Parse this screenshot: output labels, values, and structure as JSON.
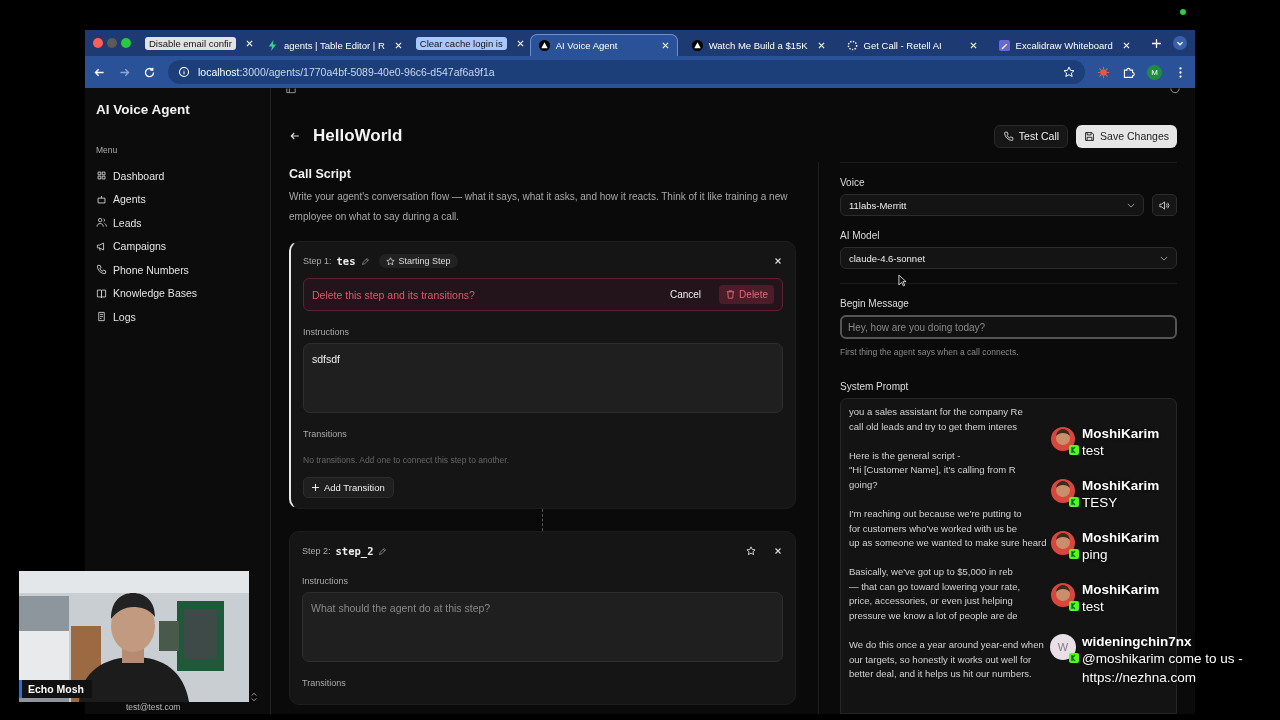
{
  "browser": {
    "tabs": [
      {
        "kind": "group",
        "label": "Disable email confir",
        "color": "#e3e3e3"
      },
      {
        "kind": "tab",
        "label": "agents | Table Editor | R",
        "selected": false
      },
      {
        "kind": "group",
        "label": "Clear cache login is",
        "color": "#a8c7fa"
      },
      {
        "kind": "tab",
        "label": "AI Voice Agent",
        "selected": true
      },
      {
        "kind": "tab",
        "label": "Watch Me Build a $15K",
        "selected": false
      },
      {
        "kind": "tab",
        "label": "Get Call - Retell AI",
        "selected": false
      },
      {
        "kind": "tab",
        "label": "Excalidraw Whiteboard",
        "selected": false
      }
    ],
    "url_host": "localhost",
    "url_path": ":3000/agents/1770a4bf-5089-40e0-96c6-d547af6a9f1a",
    "profile": "M"
  },
  "sidebar": {
    "title": "AI Voice Agent",
    "section": "Menu",
    "items": [
      {
        "label": "Dashboard"
      },
      {
        "label": "Agents"
      },
      {
        "label": "Leads"
      },
      {
        "label": "Campaigns"
      },
      {
        "label": "Phone Numbers"
      },
      {
        "label": "Knowledge Bases"
      },
      {
        "label": "Logs"
      }
    ],
    "user_email": "test@test.com"
  },
  "header": {
    "title": "HelloWorld",
    "buttons": [
      {
        "label": "Test Call",
        "kind": "secondary"
      },
      {
        "label": "Save Changes",
        "kind": "primary"
      }
    ]
  },
  "call_script": {
    "title": "Call Script",
    "description": "Write your agent's conversation flow — what it says, what it asks, and how it reacts. Think of it like training a new employee on what to say during a call.",
    "steps": [
      {
        "label": "Step 1:",
        "name": "tes",
        "active": true,
        "starting": true,
        "badge": "Starting Step",
        "confirm": {
          "message": "Delete this step and its transitions?",
          "cancel": "Cancel",
          "delete": "Delete"
        },
        "instructions_label": "Instructions",
        "instructions": "sdfsdf",
        "transitions_label": "Transitions",
        "transitions_empty": "No transitions. Add one to connect this step to another.",
        "add_transition": "Add Transition"
      },
      {
        "label": "Step 2:",
        "name": "step_2",
        "active": false,
        "starting": false,
        "instructions_label": "Instructions",
        "instructions_placeholder": "What should the agent do at this step?",
        "transitions_label": "Transitions"
      }
    ]
  },
  "settings": {
    "voice": {
      "label": "Voice",
      "value": "11labs-Merritt"
    },
    "model": {
      "label": "AI Model",
      "value": "claude-4.6-sonnet"
    },
    "begin_message": {
      "label": "Begin Message",
      "placeholder": "Hey, how are you doing today?",
      "hint": "First thing the agent says when a call connects."
    },
    "system_prompt": {
      "label": "System Prompt",
      "paragraphs": [
        [
          "you a sales assistant for the company Re",
          "call old leads and try to get them interes"
        ],
        [
          "Here is the general script -",
          "\"Hi [Customer Name], it's calling from R",
          "going?"
        ],
        [
          "I'm reaching out because we're putting to",
          "for customers who've worked with us be",
          "up as someone we wanted to make sure heard"
        ],
        [
          "Basically, we've got up to $5,000 in reb",
          "— that can go toward lowering your rate,",
          "price, accessories, or even just helping",
          "pressure we know a lot of people are de"
        ],
        [
          "We do this once a year around year-end when",
          "our targets, so honestly it works out well for",
          "better deal, and it helps us hit our numbers."
        ]
      ]
    }
  },
  "webcam": {
    "kind": "picture",
    "name": "Echo Mosh"
  },
  "chat": [
    {
      "user": "MoshiKarim",
      "text": "test"
    },
    {
      "user": "MoshiKarim",
      "text": "TESY"
    },
    {
      "user": "MoshiKarim",
      "text": "ping"
    },
    {
      "user": "MoshiKarim",
      "text": "test"
    },
    {
      "user": "wideningchin7nx",
      "text": "@moshikarim come to us - https://nezhna.com",
      "kind": "initial",
      "initial": "W"
    }
  ]
}
